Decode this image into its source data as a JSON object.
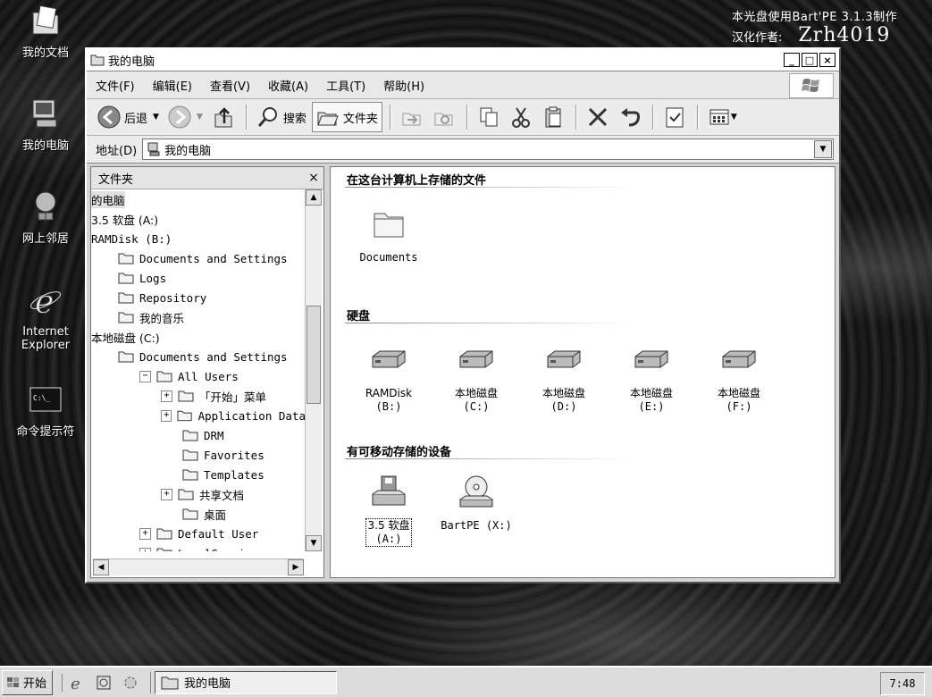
{
  "desktop": {
    "credit_line1": "本光盘使用Bart'PE 3.1.3制作",
    "credit_line2_label": "汉化作者:",
    "credit_line2_name": "Zrh4019",
    "icons": [
      {
        "label": "我的文档",
        "icon": "my-documents-icon"
      },
      {
        "label": "我的电脑",
        "icon": "my-computer-icon"
      },
      {
        "label": "网上邻居",
        "icon": "network-icon"
      },
      {
        "label": "Internet\nExplorer",
        "icon": "ie-icon"
      },
      {
        "label": "命令提示符",
        "icon": "cmd-icon"
      }
    ]
  },
  "window": {
    "title": "我的电脑",
    "menu": [
      "文件(F)",
      "编辑(E)",
      "查看(V)",
      "收藏(A)",
      "工具(T)",
      "帮助(H)"
    ],
    "toolbar": {
      "back": "后退",
      "search": "搜索",
      "folders": "文件夹"
    },
    "address": {
      "label": "地址(D)",
      "value": "我的电脑"
    },
    "folder_pane": {
      "title": "文件夹",
      "close": "×",
      "tree": [
        {
          "label": "的电脑",
          "indent": 0,
          "exp": "",
          "folder": false,
          "selected": true
        },
        {
          "label": "3.5 软盘 (A:)",
          "indent": 0,
          "exp": "",
          "folder": false
        },
        {
          "label": "RAMDisk (B:)",
          "indent": 0,
          "exp": "",
          "folder": false
        },
        {
          "label": "Documents and Settings",
          "indent": 1,
          "exp": "",
          "folder": true
        },
        {
          "label": "Logs",
          "indent": 1,
          "exp": "",
          "folder": true
        },
        {
          "label": "Repository",
          "indent": 1,
          "exp": "",
          "folder": true
        },
        {
          "label": "我的音乐",
          "indent": 1,
          "exp": "",
          "folder": true
        },
        {
          "label": "本地磁盘 (C:)",
          "indent": 0,
          "exp": "",
          "folder": false
        },
        {
          "label": "Documents and Settings",
          "indent": 1,
          "exp": "",
          "folder": true
        },
        {
          "label": "All Users",
          "indent": 2,
          "exp": "−",
          "folder": true
        },
        {
          "label": "「开始」菜单",
          "indent": 3,
          "exp": "+",
          "folder": true
        },
        {
          "label": "Application Data",
          "indent": 3,
          "exp": "+",
          "folder": true
        },
        {
          "label": "DRM",
          "indent": 4,
          "exp": "",
          "folder": true
        },
        {
          "label": "Favorites",
          "indent": 4,
          "exp": "",
          "folder": true
        },
        {
          "label": "Templates",
          "indent": 4,
          "exp": "",
          "folder": true
        },
        {
          "label": "共享文档",
          "indent": 3,
          "exp": "+",
          "folder": true
        },
        {
          "label": "桌面",
          "indent": 4,
          "exp": "",
          "folder": true
        },
        {
          "label": "Default User",
          "indent": 2,
          "exp": "+",
          "folder": true
        },
        {
          "label": "LocalService",
          "indent": 2,
          "exp": "+",
          "folder": true
        }
      ]
    },
    "main": {
      "section_files": "在这台计算机上存储的文件",
      "files": [
        {
          "label": "Documents"
        }
      ],
      "section_disks": "硬盘",
      "disks": [
        {
          "line1": "RAMDisk",
          "line2": "(B:)"
        },
        {
          "line1": "本地磁盘",
          "line2": "(C:)"
        },
        {
          "line1": "本地磁盘",
          "line2": "(D:)"
        },
        {
          "line1": "本地磁盘",
          "line2": "(E:)"
        },
        {
          "line1": "本地磁盘",
          "line2": "(F:)"
        }
      ],
      "section_removable": "有可移动存储的设备",
      "removable": [
        {
          "line1": "3.5 软盘",
          "line2": "(A:)",
          "icon": "floppy-drive-icon"
        },
        {
          "line1": "BartPE (X:)",
          "line2": "",
          "icon": "cd-drive-icon"
        }
      ]
    }
  },
  "taskbar": {
    "start": "开始",
    "task": "我的电脑",
    "clock": "7:48"
  }
}
